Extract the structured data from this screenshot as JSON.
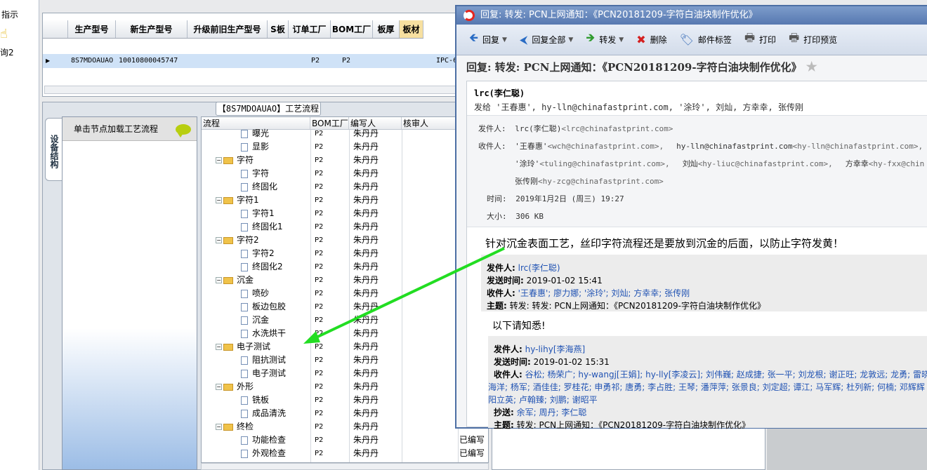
{
  "leftbar": {
    "line1": "指示",
    "line2": "询2"
  },
  "product_grid": {
    "columns": [
      "生产型号",
      "新生产型号",
      "升级前旧生产型号",
      "S板",
      "订单工厂",
      "BOM工厂",
      "板厚",
      "板材"
    ],
    "row": {
      "model": "8S7MDOAUAO",
      "new_model": "10010800045747",
      "order_factory": "P2",
      "bom_factory": "P2",
      "extra": "IPC-6"
    }
  },
  "process": {
    "title": "【8S7MDOAUAO】工艺流程",
    "side_tab": "设备结构",
    "node_hint": "单击节点加载工艺流程",
    "columns": [
      "流程",
      "BOM工厂",
      "编写人",
      "核审人"
    ],
    "rows": [
      {
        "name": "曝光",
        "type": "doc",
        "lvl": 2,
        "bom": "P2",
        "author": "朱丹丹",
        "review": ""
      },
      {
        "name": "显影",
        "type": "doc",
        "lvl": 2,
        "bom": "P2",
        "author": "朱丹丹",
        "review": ""
      },
      {
        "name": "字符",
        "type": "folder",
        "lvl": 1,
        "bom": "P2",
        "author": "朱丹丹",
        "review": ""
      },
      {
        "name": "字符",
        "type": "doc",
        "lvl": 2,
        "bom": "P2",
        "author": "朱丹丹",
        "review": ""
      },
      {
        "name": "终固化",
        "type": "doc",
        "lvl": 2,
        "bom": "P2",
        "author": "朱丹丹",
        "review": ""
      },
      {
        "name": "字符1",
        "type": "folder",
        "lvl": 1,
        "bom": "P2",
        "author": "朱丹丹",
        "review": ""
      },
      {
        "name": "字符1",
        "type": "doc",
        "lvl": 2,
        "bom": "P2",
        "author": "朱丹丹",
        "review": ""
      },
      {
        "name": "终固化1",
        "type": "doc",
        "lvl": 2,
        "bom": "P2",
        "author": "朱丹丹",
        "review": ""
      },
      {
        "name": "字符2",
        "type": "folder",
        "lvl": 1,
        "bom": "P2",
        "author": "朱丹丹",
        "review": ""
      },
      {
        "name": "字符2",
        "type": "doc",
        "lvl": 2,
        "bom": "P2",
        "author": "朱丹丹",
        "review": ""
      },
      {
        "name": "终固化2",
        "type": "doc",
        "lvl": 2,
        "bom": "P2",
        "author": "朱丹丹",
        "review": ""
      },
      {
        "name": "沉金",
        "type": "folder",
        "lvl": 1,
        "bom": "P2",
        "author": "朱丹丹",
        "review": ""
      },
      {
        "name": "喷砂",
        "type": "doc",
        "lvl": 2,
        "bom": "P2",
        "author": "朱丹丹",
        "review": ""
      },
      {
        "name": "板边包胶",
        "type": "doc",
        "lvl": 2,
        "bom": "P2",
        "author": "朱丹丹",
        "review": ""
      },
      {
        "name": "沉金",
        "type": "doc",
        "lvl": 2,
        "bom": "P2",
        "author": "朱丹丹",
        "review": ""
      },
      {
        "name": "水洗烘干",
        "type": "doc",
        "lvl": 2,
        "bom": "P2",
        "author": "朱丹丹",
        "review": ""
      },
      {
        "name": "电子测试",
        "type": "folder",
        "lvl": 1,
        "bom": "P2",
        "author": "朱丹丹",
        "review": ""
      },
      {
        "name": "阻抗测试",
        "type": "doc",
        "lvl": 2,
        "bom": "P2",
        "author": "朱丹丹",
        "review": ""
      },
      {
        "name": "电子测试",
        "type": "doc",
        "lvl": 2,
        "bom": "P2",
        "author": "朱丹丹",
        "review": ""
      },
      {
        "name": "外形",
        "type": "folder",
        "lvl": 1,
        "bom": "P2",
        "author": "朱丹丹",
        "review": ""
      },
      {
        "name": "铣板",
        "type": "doc",
        "lvl": 2,
        "bom": "P2",
        "author": "朱丹丹",
        "review": ""
      },
      {
        "name": "成品清洗",
        "type": "doc",
        "lvl": 2,
        "bom": "P2",
        "author": "朱丹丹",
        "review": ""
      },
      {
        "name": "终检",
        "type": "folder",
        "lvl": 1,
        "bom": "P2",
        "author": "朱丹丹",
        "review": ""
      },
      {
        "name": "功能检查",
        "type": "doc",
        "lvl": 2,
        "bom": "P2",
        "author": "朱丹丹",
        "review": "已编写"
      },
      {
        "name": "外观检查",
        "type": "doc",
        "lvl": 2,
        "bom": "P2",
        "author": "朱丹丹",
        "review": "已编写"
      }
    ]
  },
  "mail": {
    "window_title": "回复: 转发: PCN上网通知：《PCN20181209-字符白油块制作优化》",
    "toolbar": [
      {
        "label": "回复",
        "icon": "reply-icon",
        "glyph": "🡸",
        "color": "#2a6cc4",
        "dropdown": true
      },
      {
        "label": "回复全部",
        "icon": "reply-all-icon",
        "glyph": "⮜",
        "color": "#2a6cc4",
        "dropdown": true
      },
      {
        "label": "转发",
        "icon": "forward-icon",
        "glyph": "🡺",
        "color": "#2e9b2e",
        "dropdown": true
      },
      {
        "label": "删除",
        "icon": "delete-icon",
        "glyph": "✖",
        "color": "#d42020",
        "dropdown": false
      },
      {
        "label": "邮件标签",
        "icon": "tag-icon",
        "glyph": "🏷",
        "color": "#3b6fb8",
        "dropdown": false
      },
      {
        "label": "打印",
        "icon": "print-icon",
        "glyph": "🖶",
        "color": "#555",
        "dropdown": false
      },
      {
        "label": "打印预览",
        "icon": "print-preview-icon",
        "glyph": "🖶",
        "color": "#555",
        "dropdown": false
      }
    ],
    "subject": "回复:  转发:  PCN上网通知：《PCN20181209-字符白油块制作优化》",
    "sender_name": "lrc(李仁聪)",
    "to_line": "发给 '王春惠', hy-lln@chinafastprint.com, '涂玲', 刘灿, 方幸幸, 张传刚",
    "labels": {
      "from": "发件人:",
      "to": "收件人:",
      "time": "时间:",
      "size": "大小:"
    },
    "from_name": "lrc(李仁聪)",
    "from_addr": "<lrc@chinafastprint.com>",
    "to_r1": [
      {
        "name": "'王春惠'",
        "addr": "<wch@chinafastprint.com>,"
      },
      {
        "name": "hy-lln@chinafastprint.com",
        "addr": "<hy-lln@chinafastprint.com>,"
      }
    ],
    "to_r2": [
      {
        "name": "'涂玲'",
        "addr": "<tuling@chinafastprint.com>,"
      },
      {
        "name": "刘灿",
        "addr": "<hy-liuc@chinafastprint.com>,"
      },
      {
        "name": "方幸幸",
        "addr": "<hy-fxx@chin"
      }
    ],
    "to_r3": {
      "name": "张传刚",
      "addr": "<hy-zcg@chinafastprint.com>"
    },
    "time": "2019年1月2日 (周三) 19:27",
    "size": "306 KB",
    "body": "针对沉金表面工艺，丝印字符流程还是要放到沉金的后面，以防止字符发黄！",
    "quote1": {
      "from_label": "发件人:",
      "from": "lrc(李仁聪)",
      "sent_label": "发送时间:",
      "sent": "2019-01-02 15:41",
      "to_label": "收件人:",
      "to": "'王春惠'; 廖力娜; '涂玲'; 刘灿; 方幸幸; 张传刚",
      "subj_label": "主题:",
      "subj": "转发: 转发: PCN上网通知：《PCN20181209-字符白油块制作优化》"
    },
    "body2": "以下请知悉!",
    "quote2": {
      "from_label": "发件人:",
      "from": "hy-lihy[李海燕]",
      "sent_label": "发送时间:",
      "sent": "2019-01-02 15:31",
      "to_label": "收件人:",
      "to_1": "谷松; 杨荣广; hy-wangj[王娟]; hy-lly[李凌云]; 刘伟巍; 赵成捷; 张一平; 刘龙根; 谢正旺; 龙敦远; 龙勇; 雷晓",
      "to_2": "海洋; 杨军; 酒佳佳; 罗桂花; 申勇祁; 唐勇; 李占胜; 王琴; 潘萍萍; 张景良; 刘定超; 谭江; 马军辉; 杜列新; 何楠; 邓辉辉",
      "to_3": "阳立英; 卢翰臻; 刘鹏; 谢昭平",
      "cc_label": "抄送:",
      "cc": "余军; 周丹; 李仁聪",
      "subj_label": "主题:",
      "subj": "转发: PCN上网通知：《PCN20181209-字符白油块制作优化》"
    }
  }
}
